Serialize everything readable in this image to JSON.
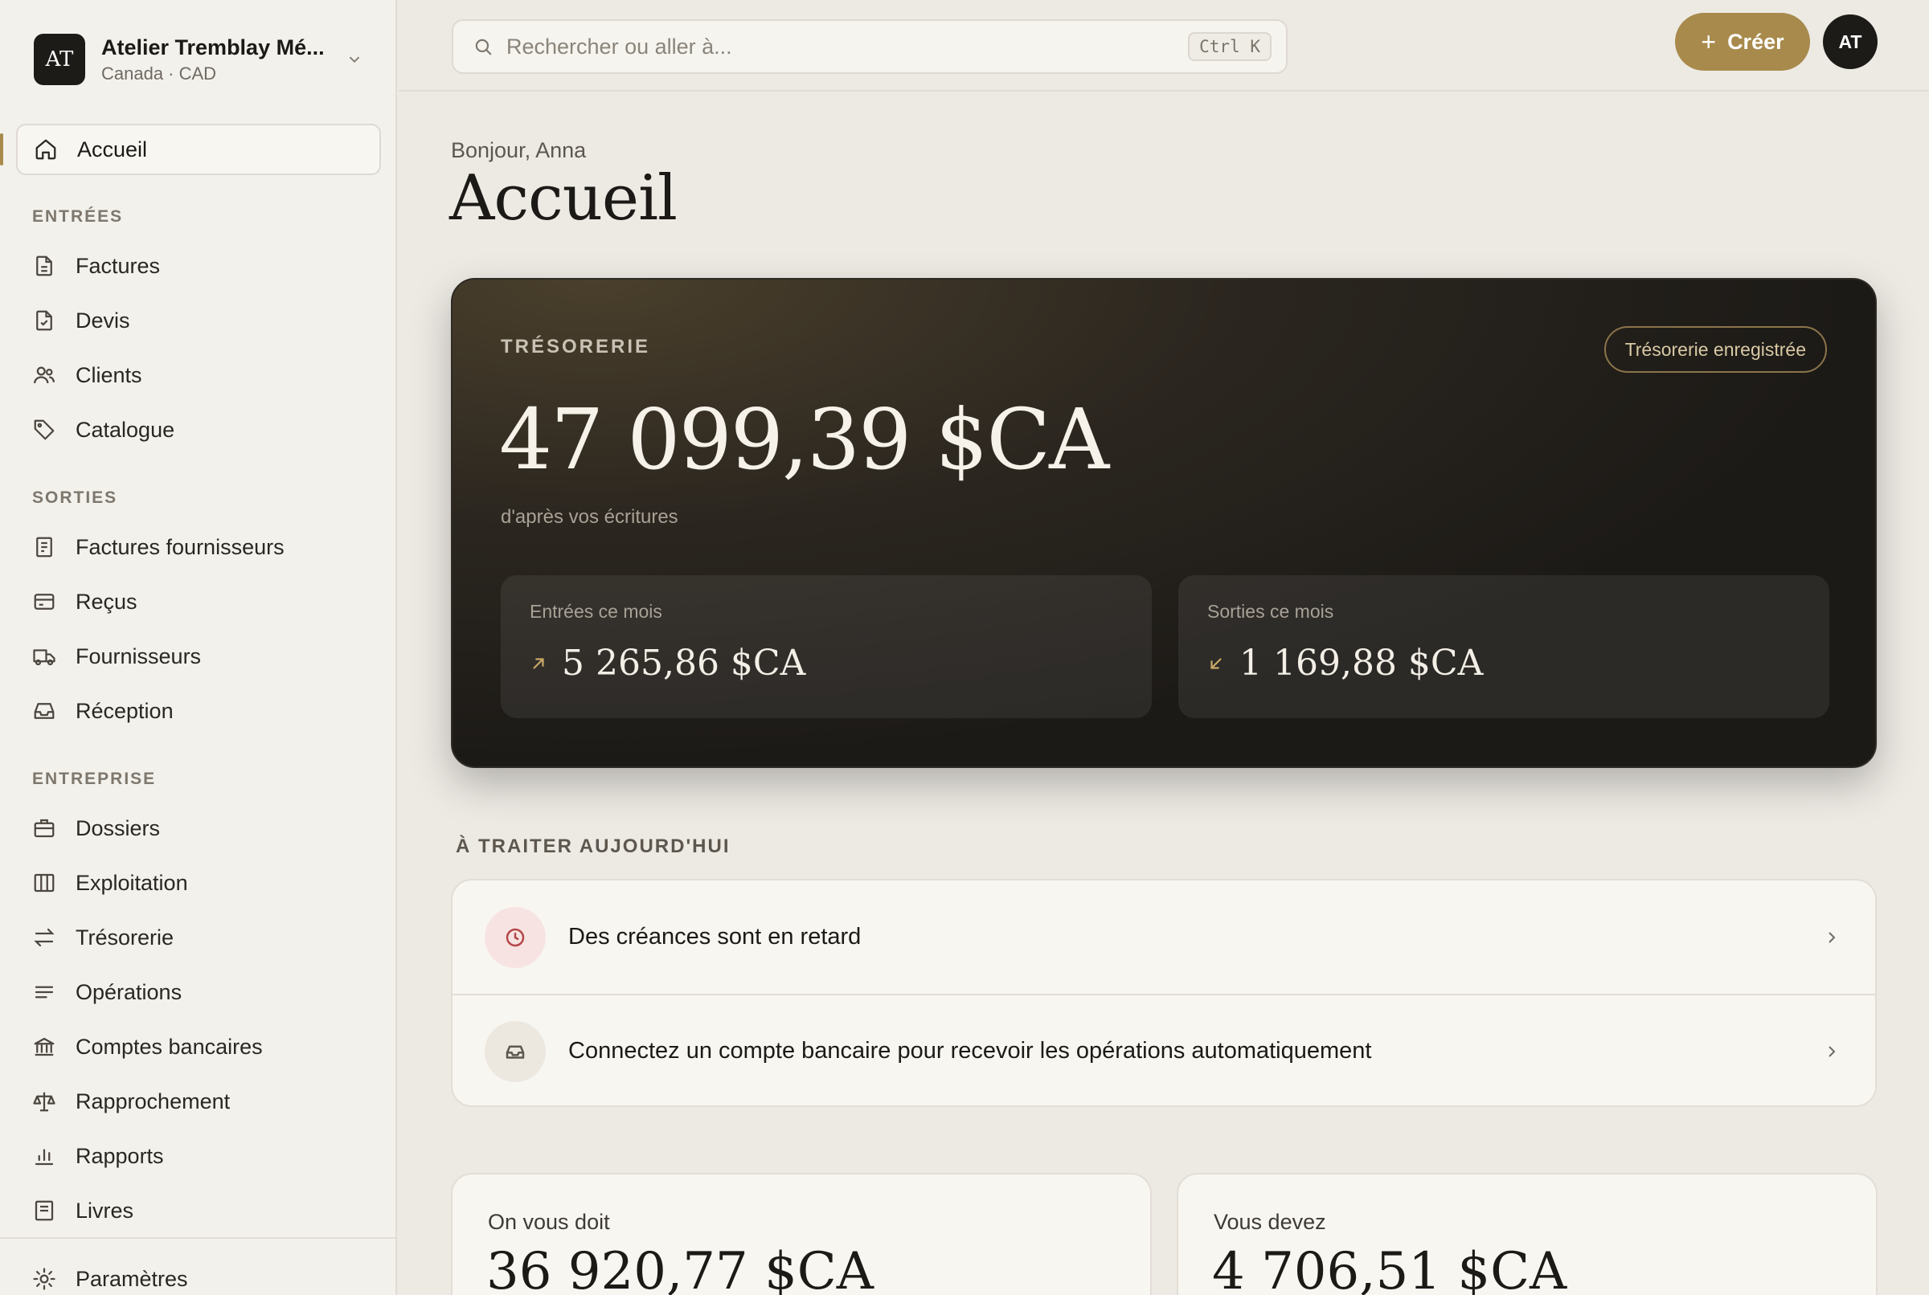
{
  "workspace": {
    "initials": "AT",
    "name": "Atelier Tremblay Mé...",
    "subtitle": "Canada · CAD",
    "icon": "chevron-down-icon"
  },
  "nav": {
    "active": {
      "label": "Accueil",
      "icon": "home-icon"
    },
    "sections": [
      {
        "title": "ENTRÉES",
        "items": [
          {
            "label": "Factures",
            "icon": "file-text-icon"
          },
          {
            "label": "Devis",
            "icon": "file-check-icon"
          },
          {
            "label": "Clients",
            "icon": "users-icon"
          },
          {
            "label": "Catalogue",
            "icon": "tag-icon"
          }
        ]
      },
      {
        "title": "SORTIES",
        "items": [
          {
            "label": "Factures fournisseurs",
            "icon": "receipt-icon"
          },
          {
            "label": "Reçus",
            "icon": "credit-card-icon"
          },
          {
            "label": "Fournisseurs",
            "icon": "truck-icon"
          },
          {
            "label": "Réception",
            "icon": "inbox-icon"
          }
        ]
      },
      {
        "title": "ENTREPRISE",
        "items": [
          {
            "label": "Dossiers",
            "icon": "briefcase-icon"
          },
          {
            "label": "Exploitation",
            "icon": "columns-icon"
          },
          {
            "label": "Trésorerie",
            "icon": "arrows-exchange-icon"
          },
          {
            "label": "Opérations",
            "icon": "list-icon"
          },
          {
            "label": "Comptes bancaires",
            "icon": "bank-icon"
          },
          {
            "label": "Rapprochement",
            "icon": "scale-icon"
          },
          {
            "label": "Rapports",
            "icon": "bar-chart-icon"
          },
          {
            "label": "Livres",
            "icon": "book-icon"
          }
        ]
      }
    ],
    "footer": {
      "label": "Paramètres",
      "icon": "gear-icon"
    }
  },
  "topbar": {
    "search_placeholder": "Rechercher ou aller à...",
    "shortcut": "Ctrl K",
    "create_label": "Créer",
    "avatar_initials": "AT"
  },
  "page": {
    "greeting": "Bonjour, Anna",
    "title": "Accueil"
  },
  "treasury": {
    "label": "TRÉSORERIE",
    "badge": "Trésorerie enregistrée",
    "amount": "47 099,39 $CA",
    "subtitle": "d'après vos écritures",
    "inflow": {
      "label": "Entrées ce mois",
      "amount": "5 265,86 $CA",
      "icon": "arrow-up-right-icon"
    },
    "outflow": {
      "label": "Sorties ce mois",
      "amount": "1 169,88 $CA",
      "icon": "arrow-down-left-icon"
    }
  },
  "todo": {
    "title": "À TRAITER AUJOURD'HUI",
    "items": [
      {
        "text": "Des créances sont en retard",
        "icon": "clock-icon"
      },
      {
        "text": "Connectez un compte bancaire pour recevoir les opérations automatiquement",
        "icon": "inbox-icon"
      }
    ]
  },
  "stats": [
    {
      "label": "On vous doit",
      "amount": "36 920,77 $CA"
    },
    {
      "label": "Vous devez",
      "amount": "4 706,51 $CA"
    }
  ],
  "colors": {
    "accent": "#a88a4c",
    "sidebar_bg": "#f3f1ec",
    "page_bg": "#edeae4",
    "dark_card": "#1c1a17",
    "overdue_icon": "#b5474a"
  }
}
